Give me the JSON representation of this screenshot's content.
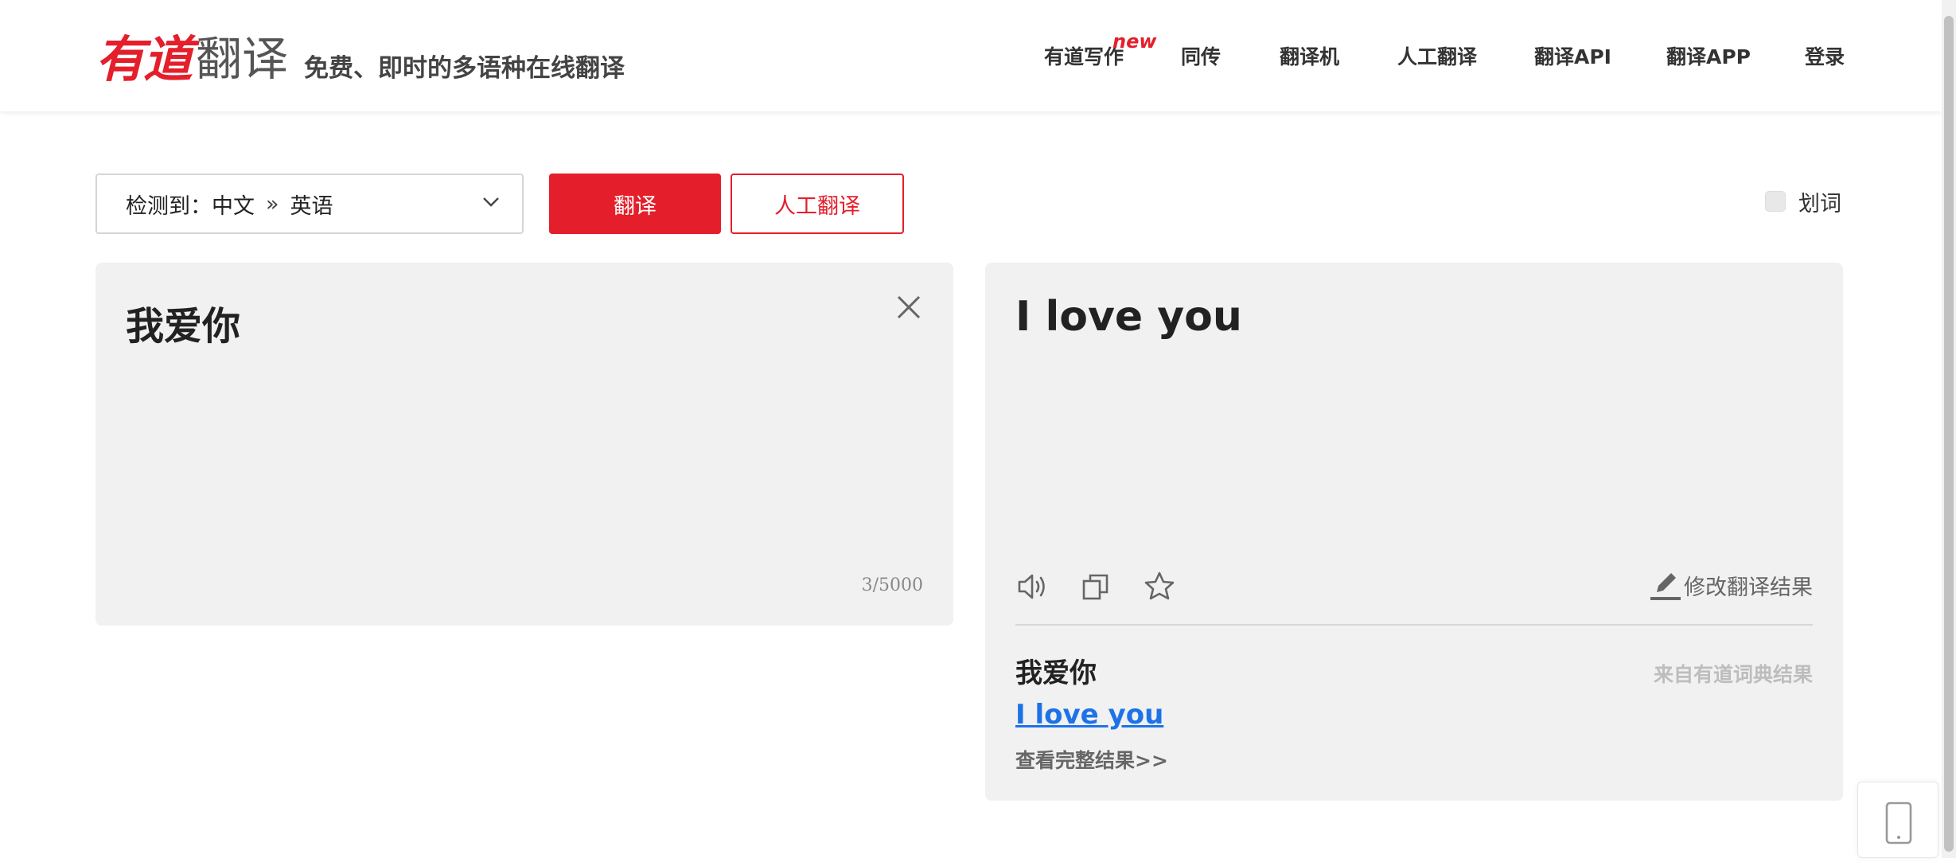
{
  "header": {
    "logo_red": "有道",
    "logo_gray": "翻译",
    "slogan": "免费、即时的多语种在线翻译",
    "nav": [
      "有道写作",
      "同传",
      "翻译机",
      "人工翻译",
      "翻译API",
      "翻译APP",
      "登录"
    ],
    "new_badge": "new"
  },
  "toolbar": {
    "lang_detected": "检测到：中文",
    "lang_sep": "»",
    "lang_target": "英语",
    "translate_label": "翻译",
    "human_label": "人工翻译",
    "checkbox_label": "划词"
  },
  "source": {
    "text": "我爱你",
    "counter": "3/5000"
  },
  "result": {
    "text": "I love you",
    "edit_label": "修改翻译结果",
    "dict_word": "我爱你",
    "dict_source": "来自有道词典结果",
    "dict_translation": "I love you",
    "dict_more": "查看完整结果>>"
  },
  "colors": {
    "brand": "#e41f2b",
    "link": "#1d72e8",
    "panel": "#f1f1f1"
  }
}
